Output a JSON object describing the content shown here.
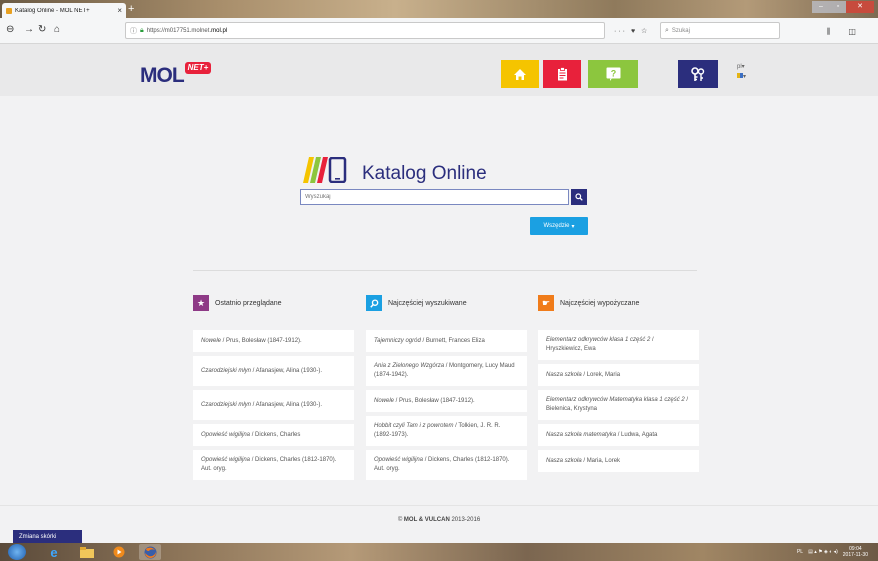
{
  "browser": {
    "tab_title": "Katalog Online - MOL NET+",
    "url_prefix": "https://m017751.molnet.",
    "url_domain": "mol.pl",
    "search_placeholder": "Szukaj"
  },
  "header": {
    "logo_text": "MOL",
    "logo_badge": "NET+",
    "lang": "pl"
  },
  "catalog": {
    "title": "Katalog Online",
    "search_placeholder": "Wyszukaj",
    "scope_label": "Wszędzie"
  },
  "columns": [
    {
      "heading": "Ostatnio przeglądane",
      "icon": "star-icon",
      "color": "#8e3a86",
      "items": [
        {
          "title": "Nowele",
          "author": " / Prus, Bolesław (1847-1912)."
        },
        {
          "title": "Czarodziejski młyn",
          "author": " / Afanasjew, Alina (1930-)."
        },
        {
          "title": "Czarodziejski młyn",
          "author": " / Afanasjew, Alina (1930-)."
        },
        {
          "title": "Opowieść wigilijna",
          "author": " / Dickens, Charles"
        },
        {
          "title": "Opowieść wigilijna",
          "author": " / Dickens, Charles (1812-1870). Aut. oryg."
        }
      ]
    },
    {
      "heading": "Najczęściej wyszukiwane",
      "icon": "search-icon",
      "color": "#1ba0e2",
      "items": [
        {
          "title": "Tajemniczy ogród",
          "author": " / Burnett, Frances Eliza"
        },
        {
          "title": "Ania z Zielonego Wzgórza",
          "author": " / Montgomery, Lucy Maud (1874-1942)."
        },
        {
          "title": "Nowele",
          "author": " / Prus, Bolesław (1847-1912)."
        },
        {
          "title": "Hobbit czyli Tam i z powrotem",
          "author": " / Tolkien, J. R. R. (1892-1973)."
        },
        {
          "title": "Opowieść wigilijna",
          "author": " / Dickens, Charles (1812-1870). Aut. oryg."
        }
      ]
    },
    {
      "heading": "Najczęściej wypożyczane",
      "icon": "hand-icon",
      "color": "#f07c1a",
      "items": [
        {
          "title": "Elementarz odkrywców klasa 1 część 2",
          "author": " / Hryszkiewicz, Ewa"
        },
        {
          "title": "Nasza szkoła",
          "author": " / Lorek, Maria"
        },
        {
          "title": "Elementarz odkrywców Matematyka klasa 1 część 2",
          "author": " / Bielenica, Krystyna"
        },
        {
          "title": "Nasza szkoła matematyka",
          "author": " / Ludwa, Agata"
        },
        {
          "title": "Nasza szkoła",
          "author": " / Maria, Lorek"
        }
      ]
    }
  ],
  "footer": {
    "copyright_prefix": "© ",
    "brand": "MOL & VULCAN",
    "years": " 2013-2016",
    "skin_button": "Zmiana skórki"
  },
  "taskbar": {
    "tray": "PL",
    "time": "09:04",
    "date": "2017-11-30"
  }
}
